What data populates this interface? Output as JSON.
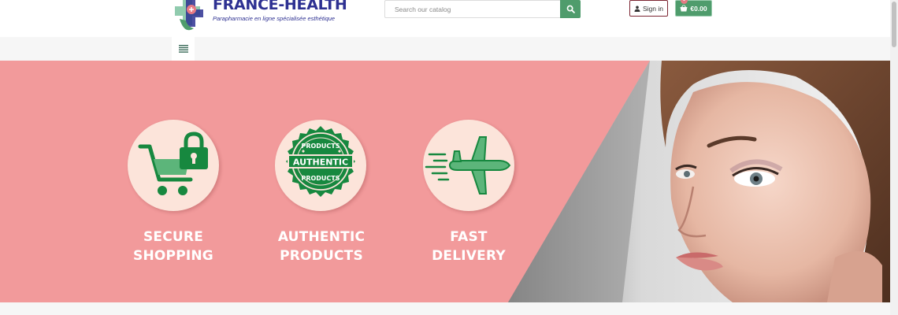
{
  "header": {
    "logo": {
      "name": "FRANCE-HEALTH",
      "tagline": "Parapharmacie en ligne spécialisée esthétique",
      "icon": "pharmacy-cross-logo"
    },
    "search": {
      "placeholder": "Search our catalog",
      "icon": "search-icon"
    },
    "signin": {
      "label": "Sign in",
      "icon": "user-icon"
    },
    "cart": {
      "total": "€0.00",
      "count": "0",
      "icon": "basket-icon"
    }
  },
  "nav": {
    "menu_icon": "hamburger-menu-icon"
  },
  "banner": {
    "features": [
      {
        "line1": "SECURE",
        "line2": "SHOPPING",
        "icon": "cart-lock-icon"
      },
      {
        "line1": "AUTHENTIC",
        "line2": "PRODUCTS",
        "icon": "authentic-products-badge-icon",
        "badge_top": "PRODUCTS",
        "badge_mid": "AUTHENTIC",
        "badge_bottom": "PRODUCTS"
      },
      {
        "line1": "FAST",
        "line2": "DELIVERY",
        "icon": "airplane-icon"
      }
    ],
    "colors": {
      "background": "#f29a9b",
      "circle": "#fce4da",
      "icon_green": "#17883f",
      "icon_light_green": "#5cb57a"
    }
  },
  "colors": {
    "brand": "#2e3192",
    "accent_green": "#4f9c6c",
    "signin_border": "#7b2431"
  }
}
